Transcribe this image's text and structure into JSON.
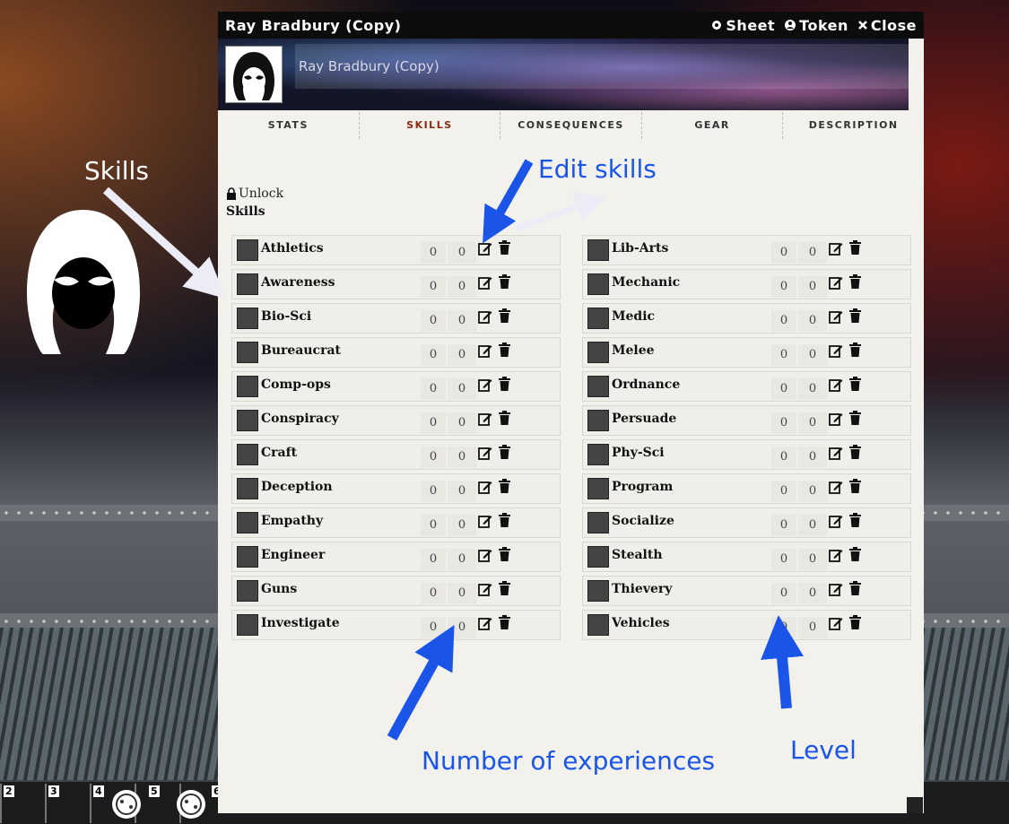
{
  "sheet": {
    "title": "Ray Bradbury (Copy)",
    "actions": [
      {
        "label": "Sheet",
        "icon": "gear-icon"
      },
      {
        "label": "Token",
        "icon": "user-icon"
      },
      {
        "label": "Close",
        "icon": "close-icon"
      }
    ],
    "character_name": "Ray Bradbury (Copy)",
    "tabs": [
      "STATS",
      "SKILLS",
      "CONSEQUENCES",
      "GEAR",
      "DESCRIPTION"
    ],
    "active_tab": "SKILLS",
    "unlock_label": "Unlock",
    "skills_heading": "Skills"
  },
  "skills_left": [
    {
      "name": "Athletics",
      "xp": "0",
      "level": "0"
    },
    {
      "name": "Awareness",
      "xp": "0",
      "level": "0"
    },
    {
      "name": "Bio-Sci",
      "xp": "0",
      "level": "0"
    },
    {
      "name": "Bureaucrat",
      "xp": "0",
      "level": "0"
    },
    {
      "name": "Comp-ops",
      "xp": "0",
      "level": "0"
    },
    {
      "name": "Conspiracy",
      "xp": "0",
      "level": "0"
    },
    {
      "name": "Craft",
      "xp": "0",
      "level": "0"
    },
    {
      "name": "Deception",
      "xp": "0",
      "level": "0"
    },
    {
      "name": "Empathy",
      "xp": "0",
      "level": "0"
    },
    {
      "name": "Engineer",
      "xp": "0",
      "level": "0"
    },
    {
      "name": "Guns",
      "xp": "0",
      "level": "0"
    },
    {
      "name": "Investigate",
      "xp": "0",
      "level": "0"
    }
  ],
  "skills_right": [
    {
      "name": "Lib-Arts",
      "xp": "0",
      "level": "0"
    },
    {
      "name": "Mechanic",
      "xp": "0",
      "level": "0"
    },
    {
      "name": "Medic",
      "xp": "0",
      "level": "0"
    },
    {
      "name": "Melee",
      "xp": "0",
      "level": "0"
    },
    {
      "name": "Ordnance",
      "xp": "0",
      "level": "0"
    },
    {
      "name": "Persuade",
      "xp": "0",
      "level": "0"
    },
    {
      "name": "Phy-Sci",
      "xp": "0",
      "level": "0"
    },
    {
      "name": "Program",
      "xp": "0",
      "level": "0"
    },
    {
      "name": "Socialize",
      "xp": "0",
      "level": "0"
    },
    {
      "name": "Stealth",
      "xp": "0",
      "level": "0"
    },
    {
      "name": "Thievery",
      "xp": "0",
      "level": "0"
    },
    {
      "name": "Vehicles",
      "xp": "0",
      "level": "0"
    }
  ],
  "annotations": {
    "skills": "Skills",
    "edit_skills": "Edit skills",
    "experiences": "Number of experiences",
    "level": "Level"
  },
  "tray": {
    "slots": [
      "2",
      "3",
      "4",
      "5",
      "6"
    ]
  },
  "colors": {
    "annotation": "#1b55e8",
    "active_tab": "#8b2a10",
    "titlebar": "#0c0c0c",
    "sheet_bg": "#f2f1ec"
  }
}
